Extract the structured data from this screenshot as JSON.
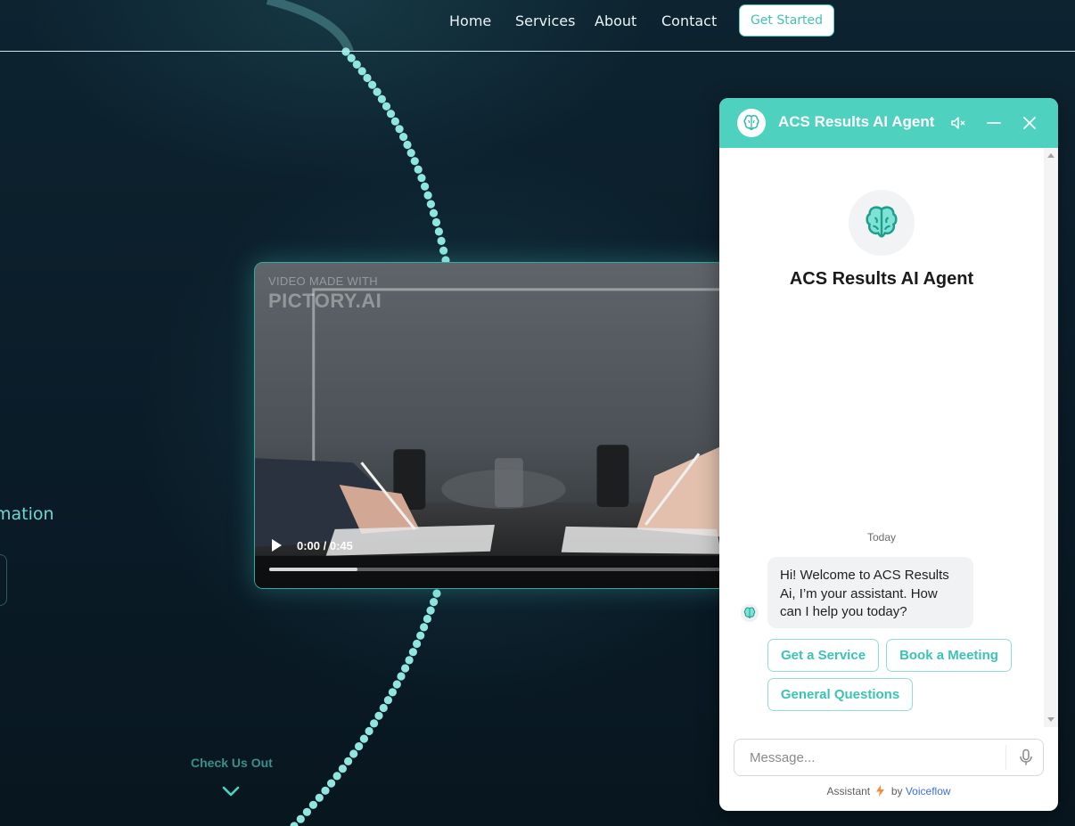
{
  "nav": {
    "links": [
      "Home",
      "Services",
      "About",
      "Contact"
    ],
    "cta_label": "Get Started"
  },
  "hero": {
    "fragment_text": "mation",
    "scroll_hint": "Check Us Out"
  },
  "video": {
    "watermark_line1": "VIDEO MADE WITH",
    "watermark_line2": "PICTORY.AI",
    "current_time": "0:00",
    "duration": "0:45",
    "time_display": "0:00 / 0:45",
    "buffered_fraction": 0.19,
    "play_icon": "play-icon"
  },
  "chat": {
    "header_title": "ACS Results AI Agent",
    "header_icons": [
      "mute-icon",
      "minimize-icon",
      "close-icon"
    ],
    "agent_name": "ACS Results AI Agent",
    "date_label": "Today",
    "welcome_message": "Hi! Welcome to ACS Results Ai, I’m your assistant. How can I help you today?",
    "quick_replies": [
      "Get a Service",
      "Book a Meeting",
      "General Questions"
    ],
    "input_placeholder": "Message...",
    "footer": {
      "prefix": "Assistant",
      "by": "by",
      "brand": "Voiceflow"
    }
  },
  "colors": {
    "accent": "#4fd1c0",
    "page_bg": "#0b1e2a",
    "dot_trail": "#8fe6df",
    "voiceflow_link": "#3d6ee6"
  }
}
